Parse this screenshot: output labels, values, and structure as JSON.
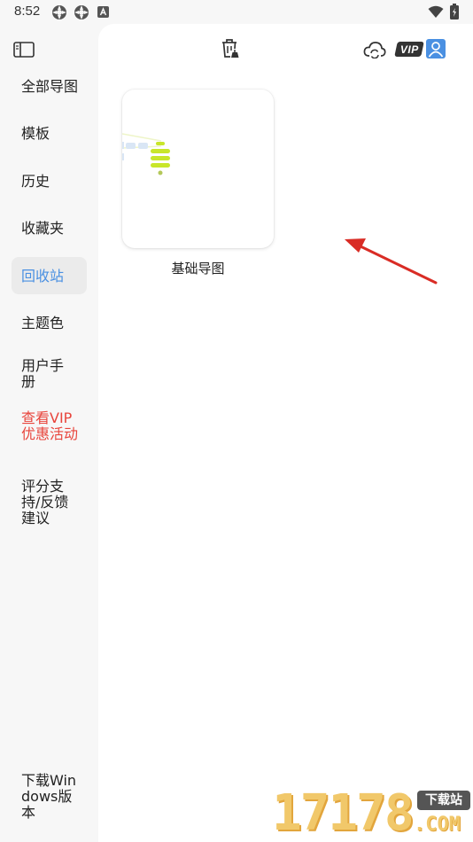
{
  "status_bar": {
    "time": "8:52"
  },
  "sidebar": {
    "items": [
      {
        "label": "全部导图"
      },
      {
        "label": "模板"
      },
      {
        "label": "历史"
      },
      {
        "label": "收藏夹"
      },
      {
        "label": "回收站"
      },
      {
        "label": "主题色"
      },
      {
        "label": "用户手册"
      },
      {
        "label": "查看VIP优惠活动"
      },
      {
        "label": "评分支持/反馈建议"
      },
      {
        "label": "下载Windows版本"
      }
    ]
  },
  "toolbar": {
    "vip_badge": "VIP"
  },
  "main": {
    "card": {
      "title": "基础导图"
    }
  },
  "watermark": {
    "number": "17178",
    "tag": "下载站",
    "domain": ".COM"
  },
  "colors": {
    "active": "#4a90e2",
    "vip_promo": "#e8453c",
    "arrow": "#d92c25",
    "accent_green": "#c8e62a"
  }
}
